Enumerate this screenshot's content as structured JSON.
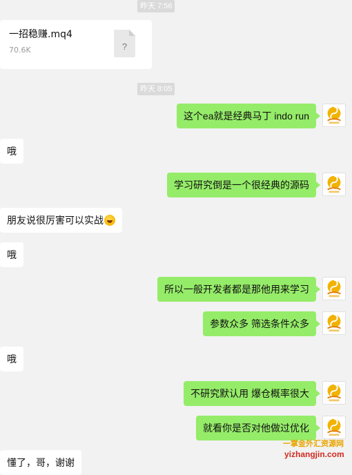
{
  "timestamps": [
    "昨天 7:56",
    "昨天 8:05"
  ],
  "file": {
    "name": "一招稳赚.mq4",
    "size": "70.6K",
    "icon_glyph": "?",
    "icon": "file-unknown-icon"
  },
  "messages": [
    {
      "from": "me",
      "text": "这个ea就是经典马丁 indo run"
    },
    {
      "from": "them",
      "text": "哦"
    },
    {
      "from": "me",
      "text": "学习研究倒是一个很经典的源码"
    },
    {
      "from": "them",
      "text": "朋友说很厉害可以实战",
      "emoji": "laugh-emoji"
    },
    {
      "from": "them",
      "text": "哦"
    },
    {
      "from": "me",
      "text": "所以一般开发者都是那他用来学习"
    },
    {
      "from": "me",
      "text": "参数众多 筛选条件众多"
    },
    {
      "from": "them",
      "text": "哦"
    },
    {
      "from": "me",
      "text": "不研究默认用 爆仓概率很大"
    },
    {
      "from": "me",
      "text": "就看你是否对他做过优化"
    },
    {
      "from": "them",
      "text": "懂了，哥，谢谢"
    }
  ],
  "avatar": {
    "caption": "一掌金",
    "colors": {
      "sun": "#f2b200",
      "ribbon": "#e07a00"
    }
  },
  "watermark": {
    "title": "一掌金外汇资源网",
    "url": "yizhangjin.com"
  },
  "colors": {
    "background": "#f2f2f2",
    "my_bubble": "#95ec69",
    "their_bubble": "#ffffff",
    "timestamp_bg": "#dadada"
  }
}
